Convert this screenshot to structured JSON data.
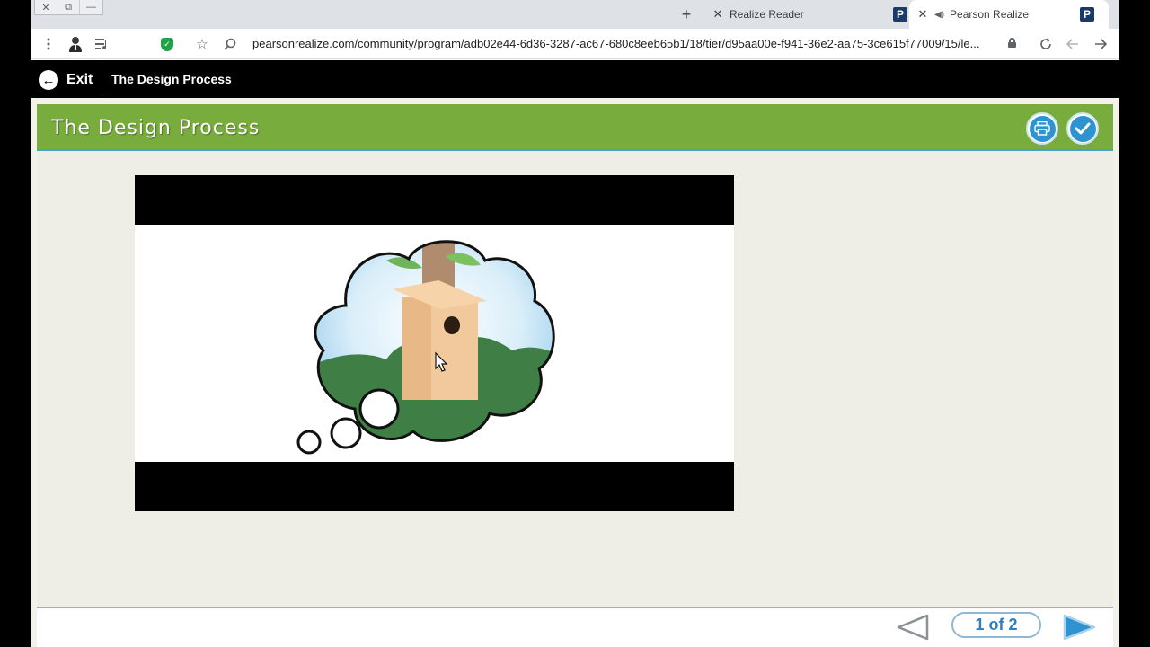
{
  "browser": {
    "window_controls": [
      "✕",
      "⧉",
      "—"
    ],
    "new_tab_symbol": "+",
    "tabs": [
      {
        "title": "Realize Reader",
        "close": "✕",
        "favicon": "P"
      },
      {
        "title": "Pearson Realize",
        "close": "✕",
        "favicon": "P",
        "audio": "◀)"
      }
    ],
    "url": "pearsonrealize.com/community/program/adb02e44-6d36-3287-ac67-680c8eeb65b1/18/tier/d95aa00e-f941-36e2-aa75-3ce615f77009/15/le..."
  },
  "app": {
    "exit_label": "Exit",
    "header_title": "The Design Process"
  },
  "lesson": {
    "heading": "The Design Process",
    "page_indicator": "1 of 2"
  },
  "colors": {
    "green_bar": "#78ad3d",
    "accent_blue": "#2f93d0",
    "page_bg": "#efeee6"
  }
}
